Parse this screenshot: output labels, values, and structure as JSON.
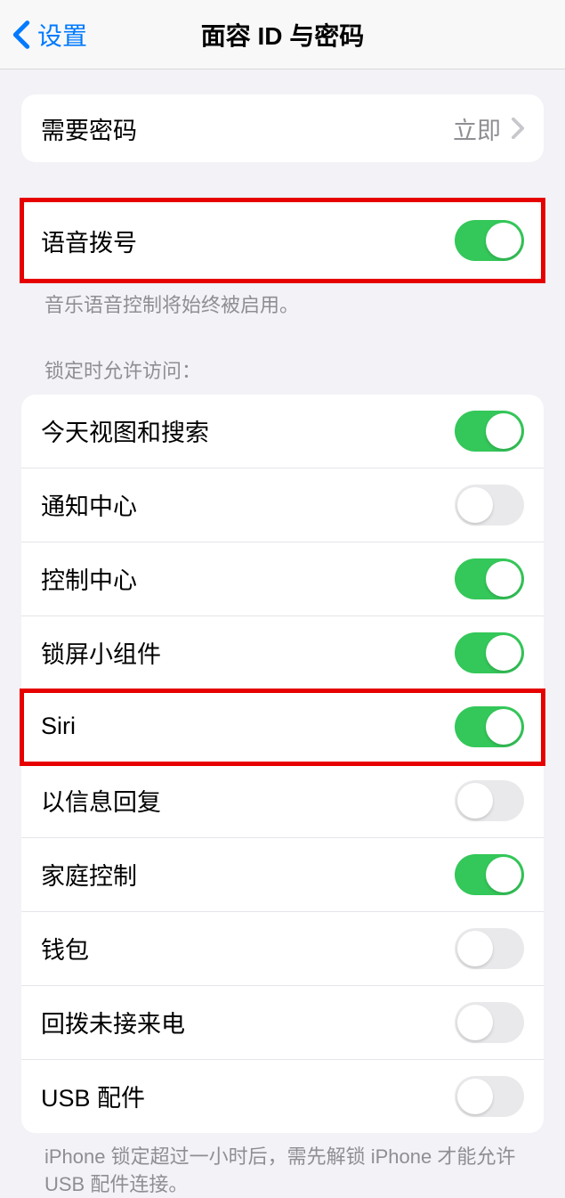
{
  "nav": {
    "back": "设置",
    "title": "面容 ID 与密码"
  },
  "passcode_section": {
    "require_passcode": {
      "label": "需要密码",
      "value": "立即"
    }
  },
  "voice_section": {
    "voice_dial": {
      "label": "语音拨号",
      "on": true
    },
    "footer": "音乐语音控制将始终被启用。"
  },
  "lock_access": {
    "header": "锁定时允许访问：",
    "items": [
      {
        "label": "今天视图和搜索",
        "on": true
      },
      {
        "label": "通知中心",
        "on": false
      },
      {
        "label": "控制中心",
        "on": true
      },
      {
        "label": "锁屏小组件",
        "on": true
      },
      {
        "label": "Siri",
        "on": true
      },
      {
        "label": "以信息回复",
        "on": false
      },
      {
        "label": "家庭控制",
        "on": true
      },
      {
        "label": "钱包",
        "on": false
      },
      {
        "label": "回拨未接来电",
        "on": false
      },
      {
        "label": "USB 配件",
        "on": false
      }
    ],
    "footer": "iPhone 锁定超过一小时后，需先解锁 iPhone 才能允许 USB 配件连接。"
  }
}
